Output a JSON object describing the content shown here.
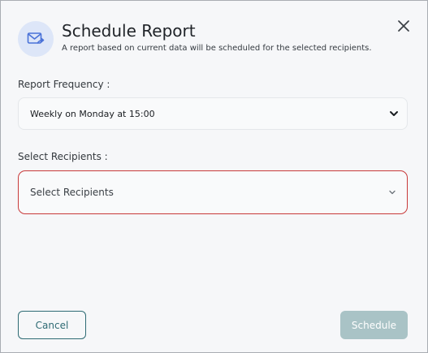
{
  "dialog": {
    "title": "Schedule Report",
    "subtitle": "A report based on current data will be scheduled for the selected recipients.",
    "header_icon": "mail-send-icon",
    "close_icon": "close-icon"
  },
  "frequency": {
    "label": "Report Frequency :",
    "value": "Weekly on Monday at 15:00"
  },
  "recipients": {
    "label": "Select Recipients :",
    "placeholder": "Select Recipients",
    "error_color": "#c83a3a"
  },
  "footer": {
    "cancel_label": "Cancel",
    "schedule_label": "Schedule",
    "schedule_disabled": true
  },
  "colors": {
    "accent": "#2e6b74",
    "disabled_button": "#a9c3c6",
    "icon_bg": "#dde6f8",
    "icon_fg": "#4a72d8"
  }
}
